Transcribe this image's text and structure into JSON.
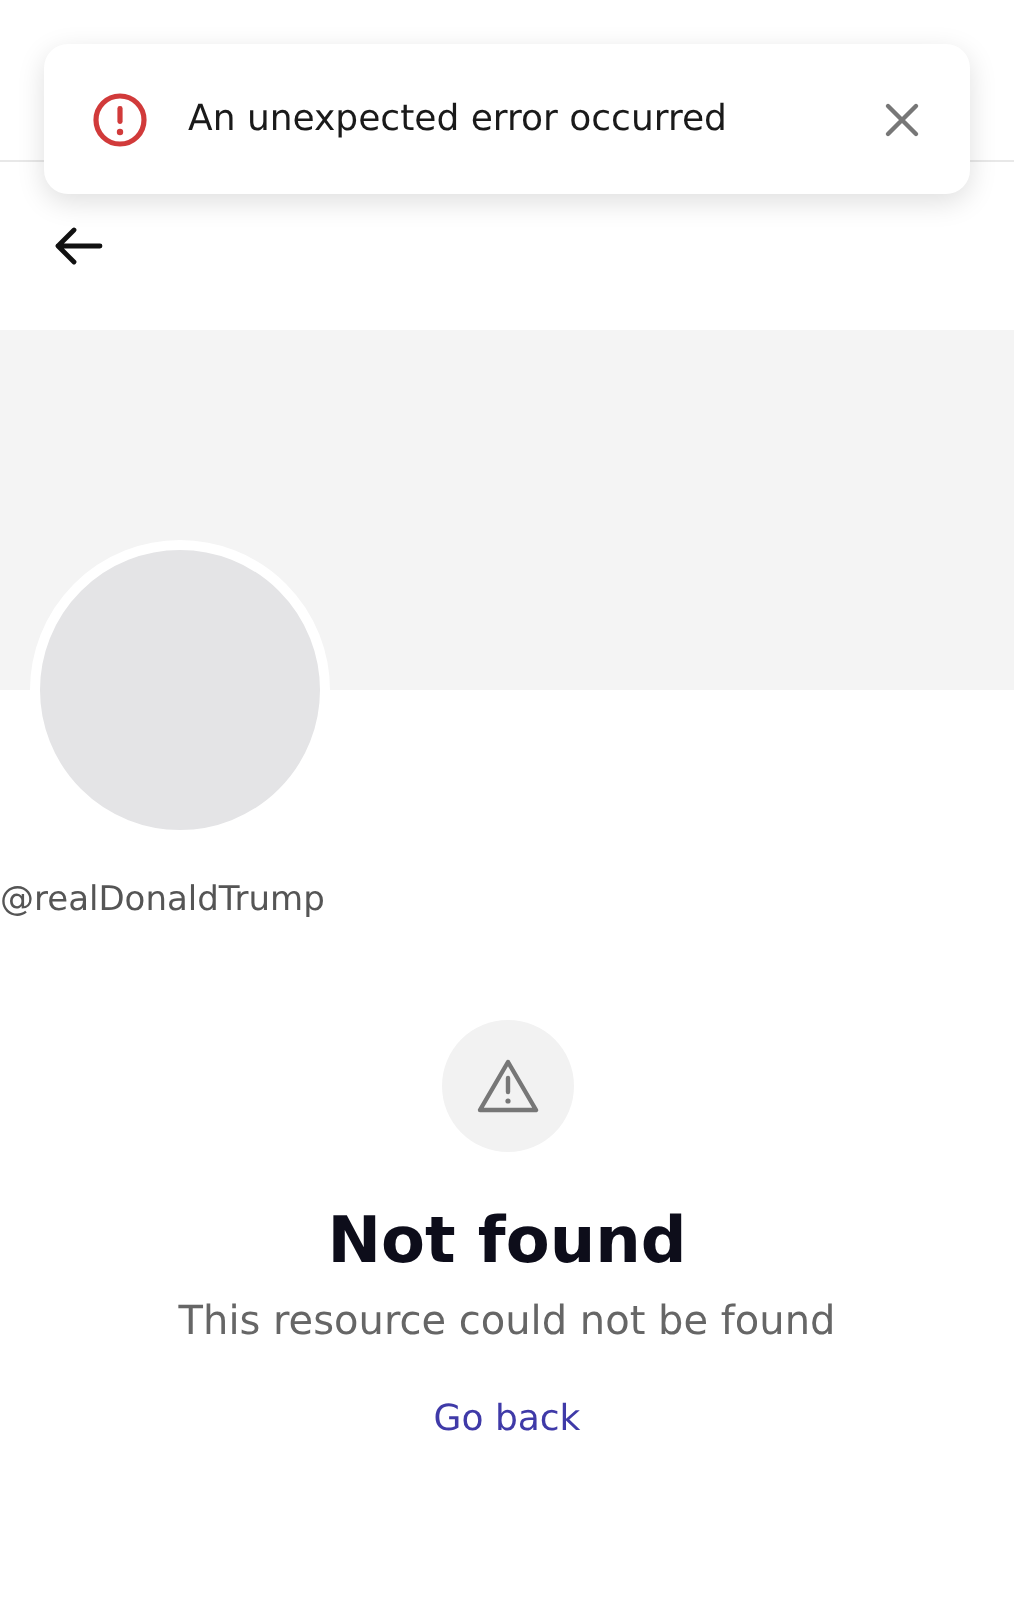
{
  "toast": {
    "message": "An unexpected error occurred"
  },
  "profile": {
    "handle": "@realDonaldTrump"
  },
  "empty_state": {
    "title": "Not found",
    "message": "This resource could not be found",
    "link": "Go back"
  }
}
